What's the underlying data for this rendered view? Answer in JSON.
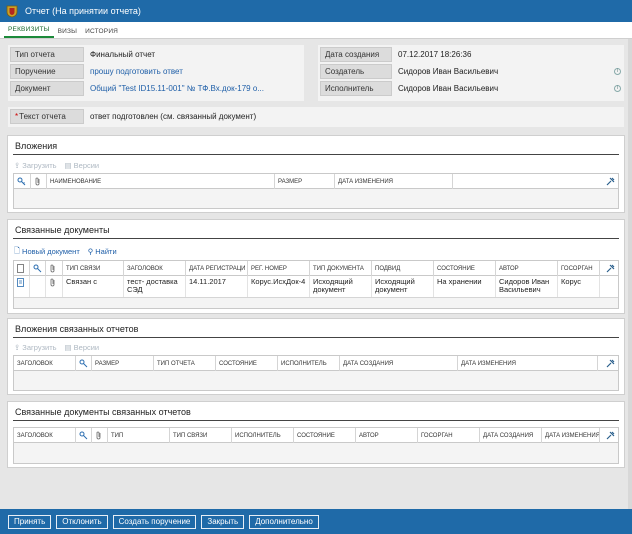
{
  "window": {
    "title": "Отчет (На принятии отчета)"
  },
  "tabs": [
    {
      "label": "РЕКВИЗИТЫ",
      "active": true
    },
    {
      "label": "ВИЗЫ",
      "active": false
    },
    {
      "label": "ИСТОРИЯ",
      "active": false
    }
  ],
  "details": {
    "report_type": {
      "label": "Тип отчета",
      "value": "Финальный отчет"
    },
    "assignment": {
      "label": "Поручение",
      "value": "прошу подготовить ответ"
    },
    "document": {
      "label": "Документ",
      "value": "Общий \"Test ID15.11-001\" № ТФ.Вх.док-179 о..."
    },
    "created_date": {
      "label": "Дата создания",
      "value": "07.12.2017 18:26:36"
    },
    "creator": {
      "label": "Создатель",
      "value": "Сидоров Иван Васильевич"
    },
    "executor": {
      "label": "Исполнитель",
      "value": "Сидоров Иван Васильевич"
    },
    "report_text": {
      "label": "Текст отчета",
      "value": "ответ подготовлен (см. связанный документ)",
      "required_mark": "*"
    }
  },
  "attachments": {
    "title": "Вложения",
    "toolbar": {
      "upload": "Загрузить",
      "versions": "Версии"
    },
    "columns": {
      "name": "НАИМЕНОВАНИЕ",
      "size": "РАЗМЕР",
      "modified": "ДАТА ИЗМЕНЕНИЯ"
    }
  },
  "related_docs": {
    "title": "Связанные документы",
    "toolbar": {
      "new_doc": "Новый документ",
      "find": "Найти"
    },
    "columns": {
      "link_type": "ТИП СВЯЗИ",
      "heading": "ЗАГОЛОВОК",
      "reg_date": "ДАТА РЕГИСТРАЦИ",
      "reg_number": "РЕГ. НОМЕР",
      "doc_type": "ТИП ДОКУМЕНТА",
      "subtype": "ПОДВИД",
      "state": "СОСТОЯНИЕ",
      "author": "АВТОР",
      "gov_org": "ГОСОРГАН"
    },
    "rows": [
      {
        "link_type": "Связан с",
        "heading": "тест- доставка СЭД",
        "reg_date": "14.11.2017",
        "reg_number": "Корус.ИсхДок-4",
        "doc_type": "Исходящий документ",
        "subtype": "Исходящий документ",
        "state": "На хранении",
        "author": "Сидоров Иван Васильевич",
        "gov_org": "Корус"
      }
    ]
  },
  "related_report_attachments": {
    "title": "Вложения связанных отчетов",
    "toolbar": {
      "upload": "Загрузить",
      "versions": "Версии"
    },
    "columns": {
      "heading": "ЗАГОЛОВОК",
      "size": "РАЗМЕР",
      "report_type": "ТИП ОТЧЕТА",
      "state": "СОСТОЯНИЕ",
      "executor": "ИСПОЛНИТЕЛЬ",
      "created": "ДАТА СОЗДАНИЯ",
      "modified": "ДАТА ИЗМЕНЕНИЯ"
    }
  },
  "related_report_docs": {
    "title": "Связанные документы связанных отчетов",
    "columns": {
      "heading": "ЗАГОЛОВОК",
      "type": "ТИП",
      "link_type": "ТИП СВЯЗИ",
      "executor": "ИСПОЛНИТЕЛЬ",
      "state": "СОСТОЯНИЕ",
      "author": "АВТОР",
      "gov_org": "ГОСОРГАН",
      "created": "ДАТА СОЗДАНИЯ",
      "modified": "ДАТА ИЗМЕНЕНИЯ"
    }
  },
  "footer": {
    "accept": "Принять",
    "reject": "Отклонить",
    "create_assignment": "Создать поручение",
    "close": "Закрыть",
    "more": "Дополнительно"
  },
  "colors": {
    "accent": "#1f6aa8",
    "tab_active": "#1c8a3a",
    "link": "#1f5fa8"
  }
}
